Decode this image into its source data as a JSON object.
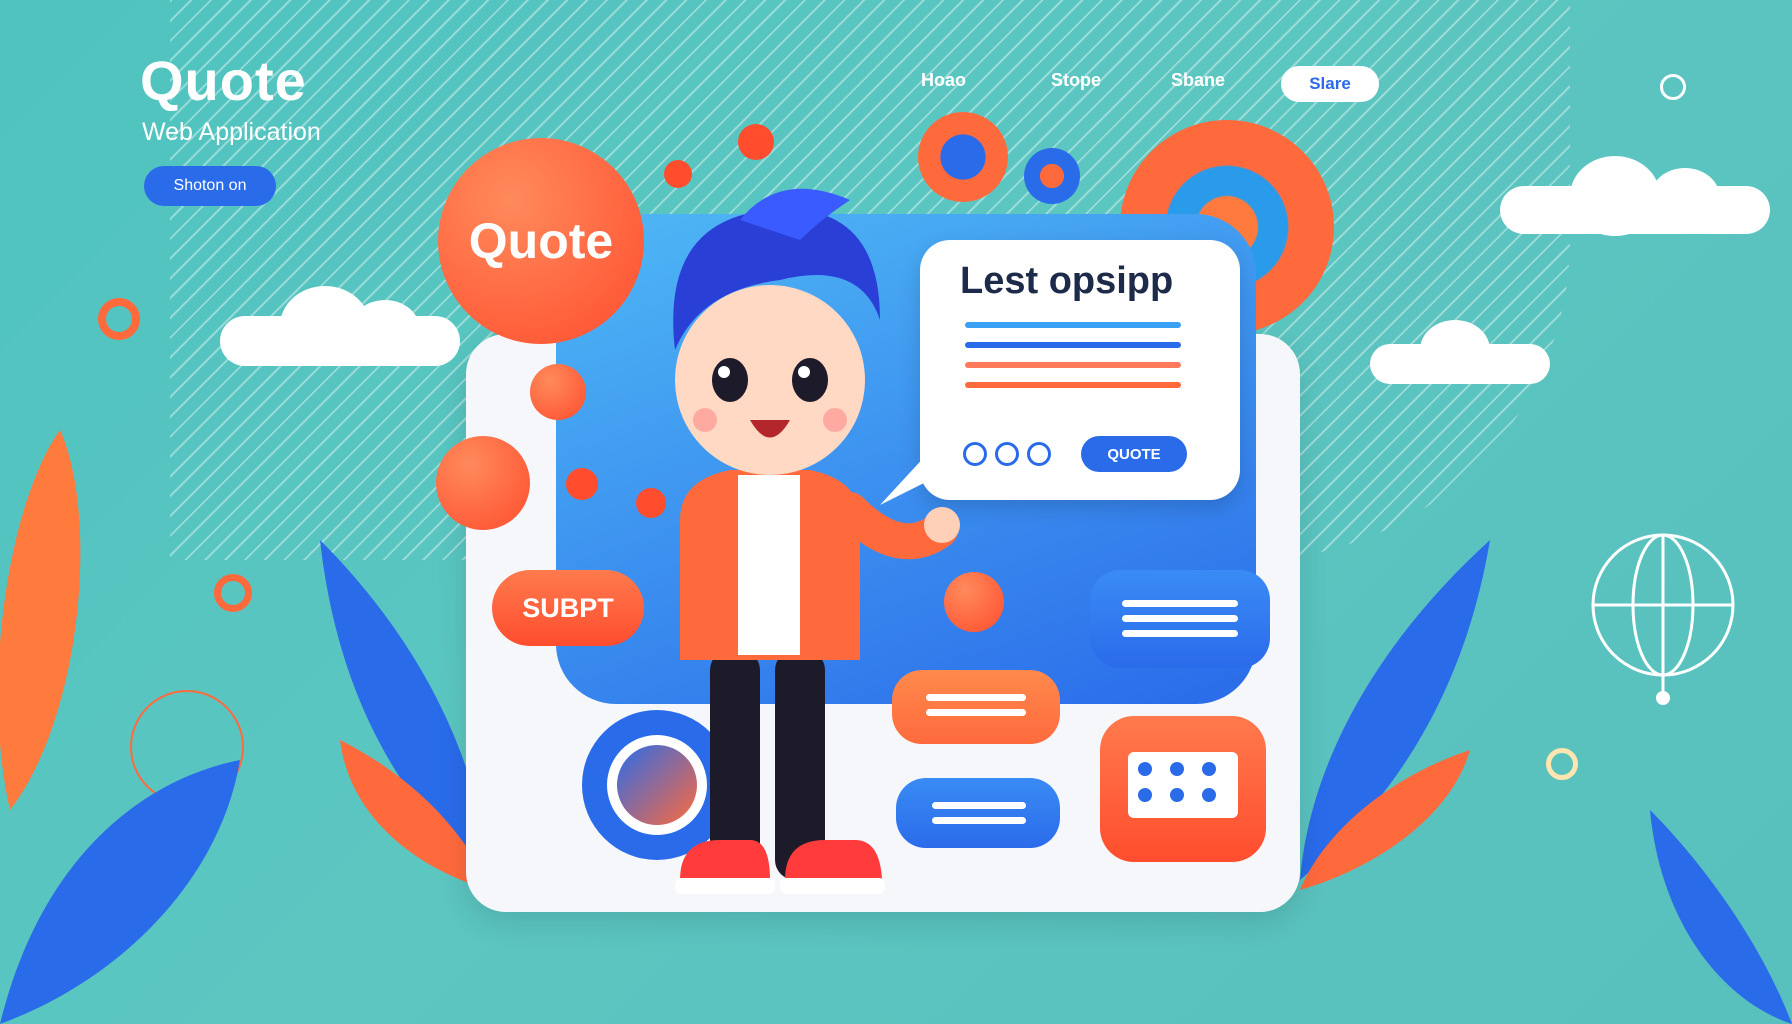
{
  "brand": {
    "title": "Quote",
    "subtitle": "Web Application",
    "cta_label": "Shoton on"
  },
  "nav": {
    "items": [
      {
        "label": "Hoao"
      },
      {
        "label": "Stope"
      },
      {
        "label": "Sbane"
      },
      {
        "label": "Slare",
        "active": true
      }
    ]
  },
  "hero": {
    "quote_badge": "Quote",
    "speech_title": "Lest opsipp",
    "speech_button": "QUOTE",
    "submit_pill": "SUBPT"
  },
  "colors": {
    "background": "#55c4bf",
    "primary_blue": "#2a6bea",
    "accent_orange": "#ff6a3d",
    "white": "#ffffff"
  },
  "icons": [
    "globe-icon",
    "chat-icon",
    "sparkle-icon"
  ]
}
